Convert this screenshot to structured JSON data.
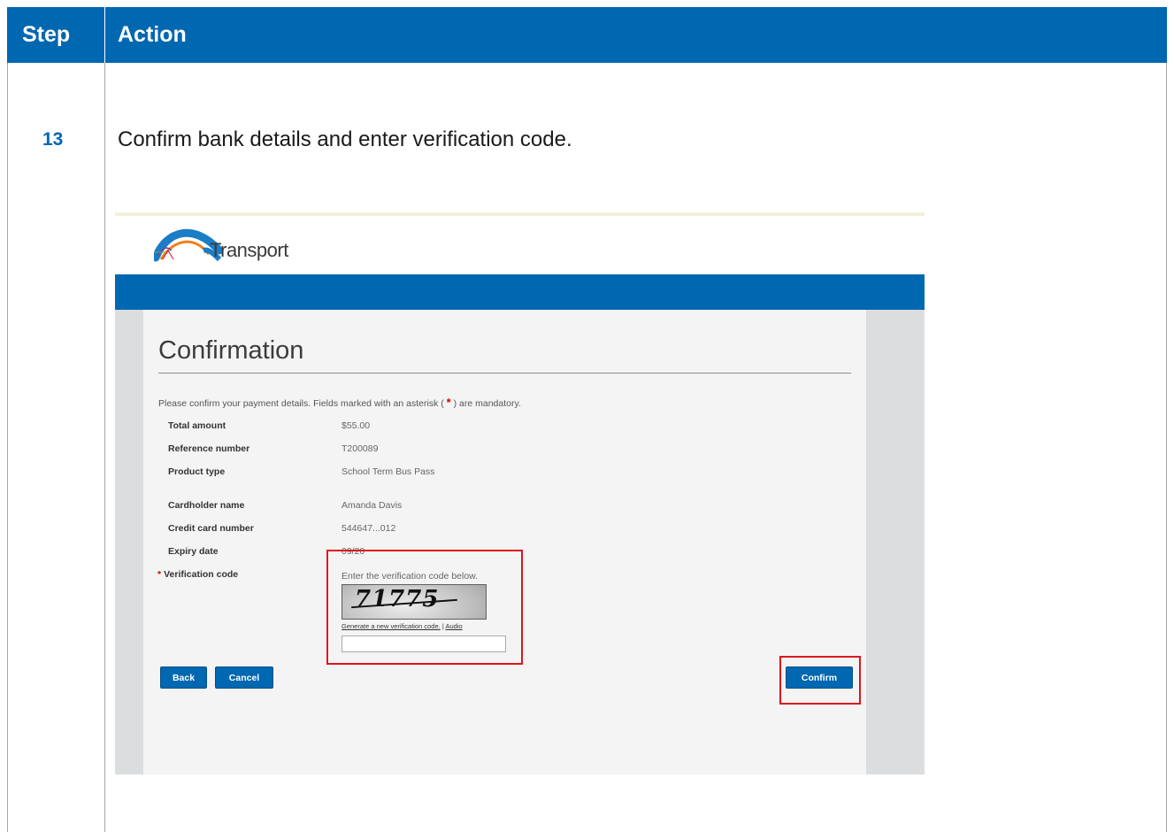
{
  "table_header": {
    "step": "Step",
    "action": "Action"
  },
  "step": {
    "number": "13",
    "instruction": "Confirm bank details and enter verification code."
  },
  "screenshot": {
    "logo_text": "Transport",
    "title": "Confirmation",
    "intro_before": "Please confirm your payment details. Fields marked with an asterisk ( ",
    "intro_asterisk": "*",
    "intro_after": " ) are mandatory.",
    "fields": [
      {
        "label": "Total amount",
        "value": "$55.00"
      },
      {
        "label": "Reference number",
        "value": "T200089"
      },
      {
        "label": "Product type",
        "value": "School Term Bus Pass"
      },
      {
        "label": "Cardholder name",
        "value": "Amanda Davis"
      },
      {
        "label": "Credit card number",
        "value": "544647...012"
      },
      {
        "label": "Expiry date",
        "value": "09/20"
      }
    ],
    "verification": {
      "required_marker": "*",
      "label": "Verification code",
      "instruction": "Enter the verification code below.",
      "captcha_text": "71775",
      "new_code_link": "Generate a new verification code.",
      "separator": "|",
      "audio_link": "Audio",
      "input_value": ""
    },
    "buttons": {
      "back": "Back",
      "cancel": "Cancel",
      "confirm": "Confirm"
    },
    "colors": {
      "brand_blue": "#0067b1",
      "highlight_red": "#e0151b",
      "required_red": "#d20000"
    }
  }
}
